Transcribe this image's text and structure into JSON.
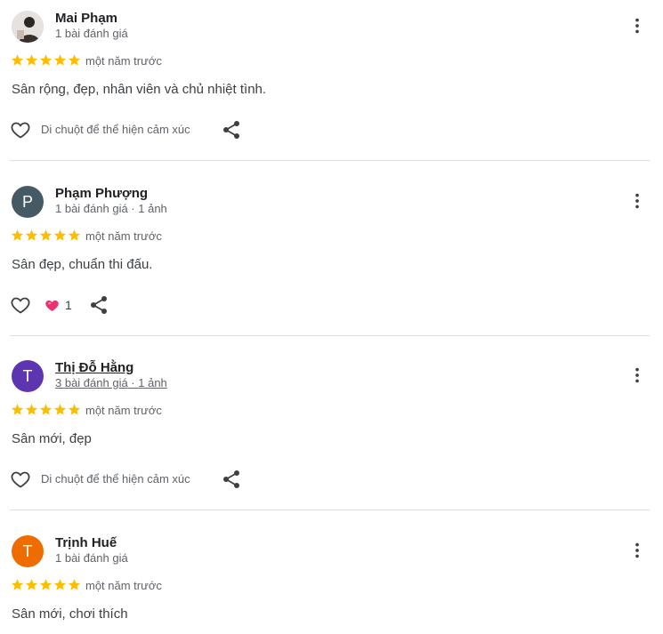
{
  "colors": {
    "star": "#fbbc04",
    "divider": "#dadce0",
    "heart_reaction": "#e8336e"
  },
  "reviews": [
    {
      "name": "Mai Phạm",
      "meta": "1 bài đánh giá",
      "meta_photos": "",
      "avatar_letter": "",
      "avatar_color": "#d9d6d3",
      "rating": 5,
      "time": "một năm trước",
      "text": "Sân rộng, đẹp, nhân viên và chủ nhiệt tình.",
      "reaction_hint": "Di chuột để thể hiện cảm xúc",
      "reaction_count": ""
    },
    {
      "name": "Phạm Phượng",
      "meta": "1 bài đánh giá",
      "meta_photos": "1 ảnh",
      "avatar_letter": "P",
      "avatar_color": "#455a64",
      "rating": 5,
      "time": "một năm trước",
      "text": "Sân đẹp, chuẩn thi đấu.",
      "reaction_hint": "",
      "reaction_count": "1"
    },
    {
      "name": "Thị Đỗ Hằng",
      "meta": "3 bài đánh giá",
      "meta_photos": "1 ảnh",
      "avatar_letter": "T",
      "avatar_color": "#5e35b1",
      "rating": 5,
      "time": "một năm trước",
      "text": "Sân mới, đẹp",
      "reaction_hint": "Di chuột để thể hiện cảm xúc",
      "reaction_count": ""
    },
    {
      "name": "Trịnh Huế",
      "meta": "1 bài đánh giá",
      "meta_photos": "",
      "avatar_letter": "T",
      "avatar_color": "#ef6c00",
      "rating": 5,
      "time": "một năm trước",
      "text": "Sân mới, chơi thích",
      "reaction_hint": "",
      "reaction_count": ""
    }
  ]
}
